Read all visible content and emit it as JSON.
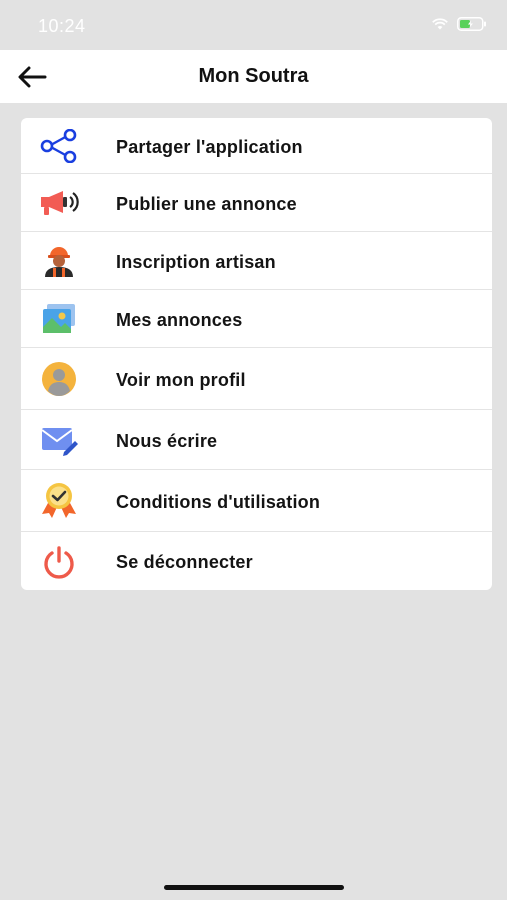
{
  "status_bar": {
    "time": "10:24"
  },
  "header": {
    "title": "Mon Soutra",
    "back_icon": "arrow-left-icon"
  },
  "menu": {
    "items": [
      {
        "label": "Partager l'application",
        "icon": "share-icon",
        "color": "#1a3fe0"
      },
      {
        "label": "Publier une annonce",
        "icon": "megaphone-icon",
        "color": "#f25c54"
      },
      {
        "label": "Inscription artisan",
        "icon": "worker-icon",
        "color": "#f2662b"
      },
      {
        "label": "Mes annonces",
        "icon": "image-gallery-icon",
        "color": "#4aa3e8"
      },
      {
        "label": "Voir mon profil",
        "icon": "user-profile-icon",
        "color": "#f4b33d"
      },
      {
        "label": "Nous écrire",
        "icon": "mail-edit-icon",
        "color": "#6f8ff0"
      },
      {
        "label": "Conditions d'utilisation",
        "icon": "badge-check-icon",
        "color": "#f5c542"
      },
      {
        "label": "Se déconnecter",
        "icon": "power-icon",
        "color": "#ee5a4a"
      }
    ]
  }
}
